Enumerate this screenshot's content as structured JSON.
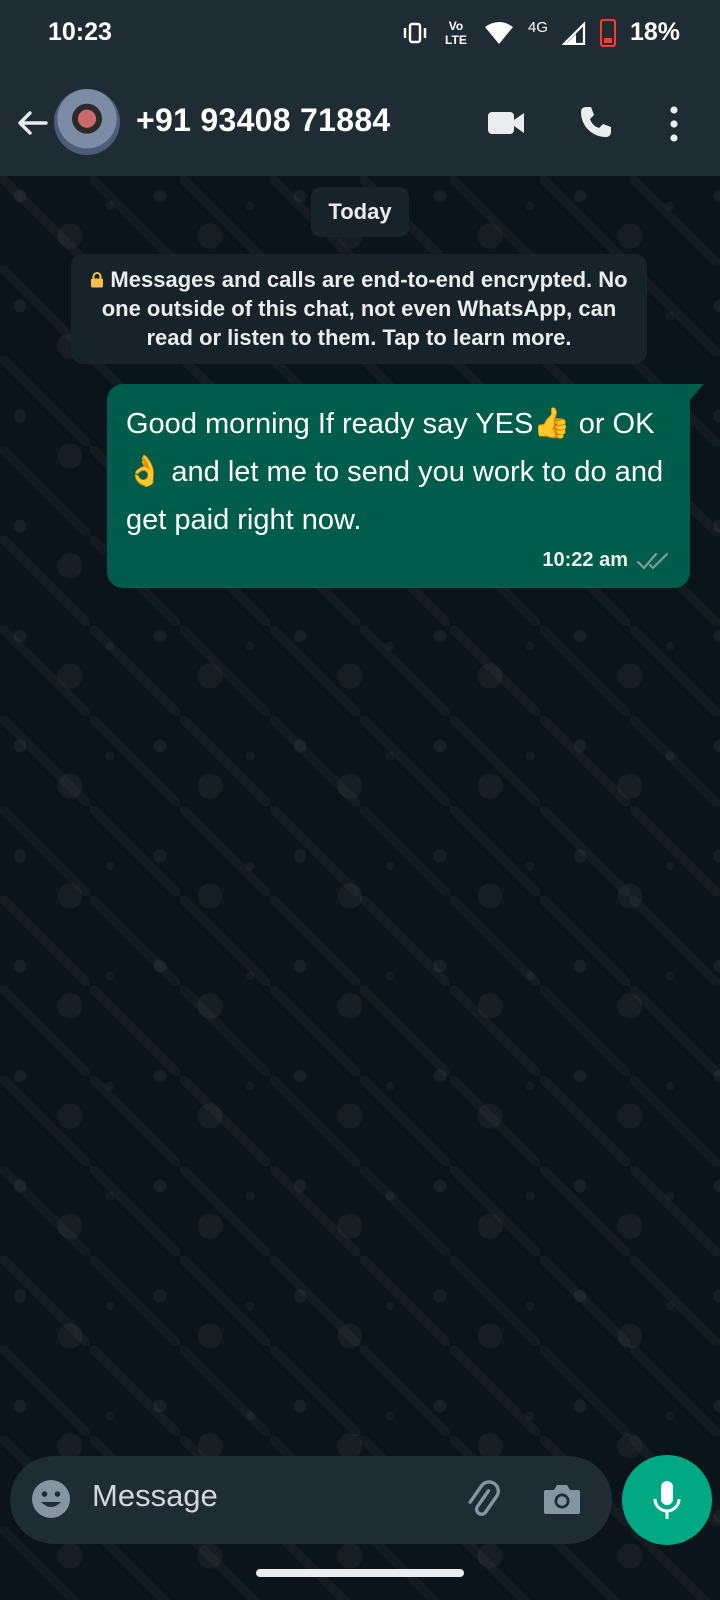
{
  "status_bar": {
    "time": "10:23",
    "network_label": "Vo LTE",
    "signal_label": "4G",
    "battery_percent": "18%"
  },
  "header": {
    "contact_name": "+91 93408 71884"
  },
  "chat": {
    "date_chip": "Today",
    "encryption_notice": "Messages and calls are end-to-end encrypted. No one outside of this chat, not even WhatsApp, can read or listen to them. Tap to learn more.",
    "messages": [
      {
        "direction": "outgoing",
        "text_part1": "Good morning If ready say YES",
        "emoji1": "👍",
        "text_part2": " or OK ",
        "emoji2": "👌",
        "text_part3": " and let me to send you work to do and get paid right now.",
        "time": "10:22 am",
        "status": "read"
      }
    ]
  },
  "composer": {
    "placeholder": "Message"
  },
  "colors": {
    "header_bg": "#1f2c34",
    "chat_bg": "#0b141a",
    "outgoing_bubble": "#005c4b",
    "accent": "#00a884"
  }
}
